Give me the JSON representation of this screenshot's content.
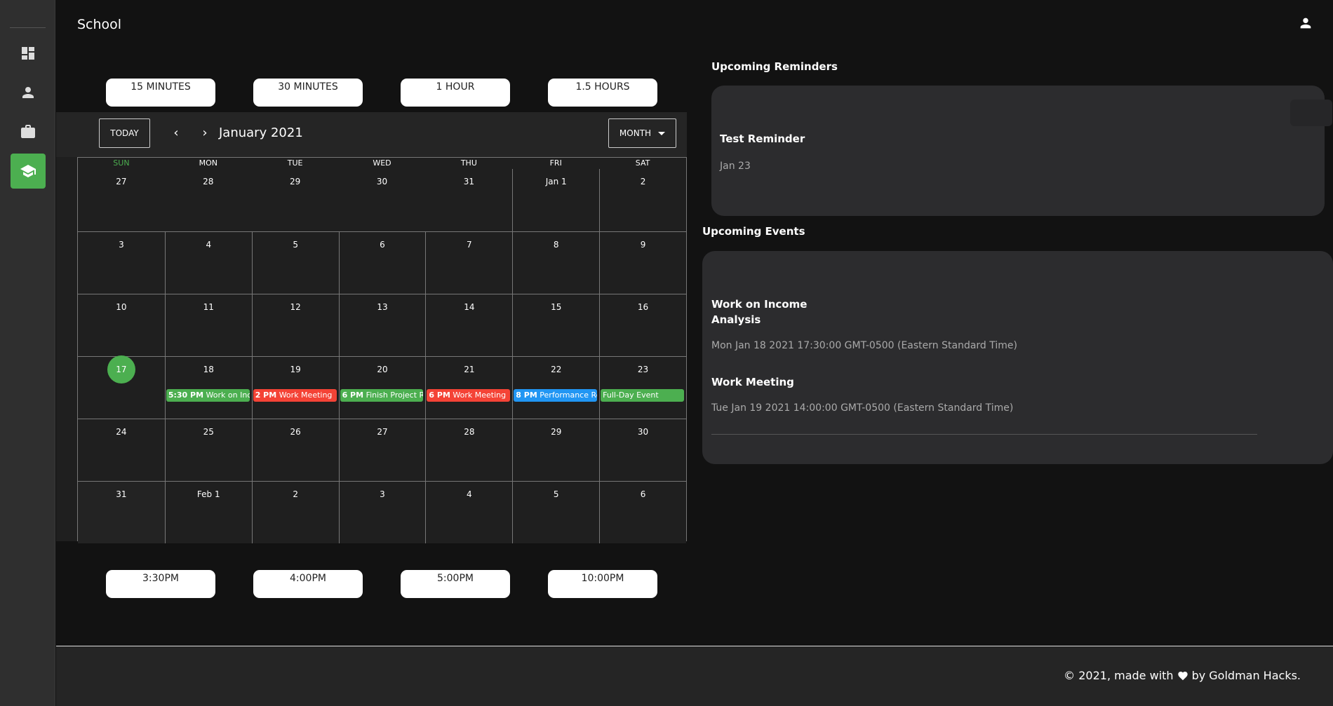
{
  "header": {
    "title": "School"
  },
  "sidebar": {
    "items": [
      {
        "name": "dashboard",
        "icon": "dashboard-icon"
      },
      {
        "name": "person",
        "icon": "person-icon"
      },
      {
        "name": "work",
        "icon": "briefcase-icon"
      },
      {
        "name": "school",
        "icon": "school-icon",
        "active": true
      }
    ]
  },
  "durations": [
    "15 MINUTES",
    "30 MINUTES",
    "1 HOUR",
    "1.5 HOURS"
  ],
  "times": [
    "3:30PM",
    "4:00PM",
    "5:00PM",
    "10:00PM"
  ],
  "calendar": {
    "today_label": "TODAY",
    "prev": "‹",
    "next": "›",
    "month_label": "January 2021",
    "view_label": "MONTH",
    "dow": [
      "SUN",
      "MON",
      "TUE",
      "WED",
      "THU",
      "FRI",
      "SAT"
    ],
    "weeks": [
      [
        "27",
        "28",
        "29",
        "30",
        "31",
        "Jan 1",
        "2"
      ],
      [
        "3",
        "4",
        "5",
        "6",
        "7",
        "8",
        "9"
      ],
      [
        "10",
        "11",
        "12",
        "13",
        "14",
        "15",
        "16"
      ],
      [
        "17",
        "18",
        "19",
        "20",
        "21",
        "22",
        "23"
      ],
      [
        "24",
        "25",
        "26",
        "27",
        "28",
        "29",
        "30"
      ],
      [
        "31",
        "Feb 1",
        "2",
        "3",
        "4",
        "5",
        "6"
      ]
    ],
    "events": [
      {
        "time": "5:30 PM",
        "title": "Work on Income Analysis",
        "color": "#4caf50"
      },
      {
        "time": "2 PM",
        "title": "Work Meeting",
        "color": "#f44336"
      },
      {
        "time": "6 PM",
        "title": "Finish Project Report",
        "color": "#4caf50"
      },
      {
        "time": "6 PM",
        "title": "Work Meeting",
        "color": "#f44336"
      },
      {
        "time": "8 PM",
        "title": "Performance Review",
        "color": "#2196f3"
      },
      {
        "time": "",
        "title": "Full-Day Event",
        "color": "#4caf50"
      }
    ]
  },
  "reminders": {
    "heading": "Upcoming Reminders",
    "items": [
      {
        "title": "Test Reminder",
        "date": "Jan 23"
      }
    ]
  },
  "upcoming_events": {
    "heading": "Upcoming Events",
    "items": [
      {
        "title": "Work on Income Analysis",
        "date": "Mon Jan 18 2021 17:30:00 GMT-0500 (Eastern Standard Time)"
      },
      {
        "title": "Work Meeting",
        "date": "Tue Jan 19 2021 14:00:00 GMT-0500 (Eastern Standard Time)"
      }
    ]
  },
  "footer": {
    "prefix": "© 2021, made with",
    "suffix": "by Goldman Hacks."
  },
  "colors": {
    "accent": "#4caf50",
    "red": "#f44336",
    "blue": "#2196f3"
  }
}
